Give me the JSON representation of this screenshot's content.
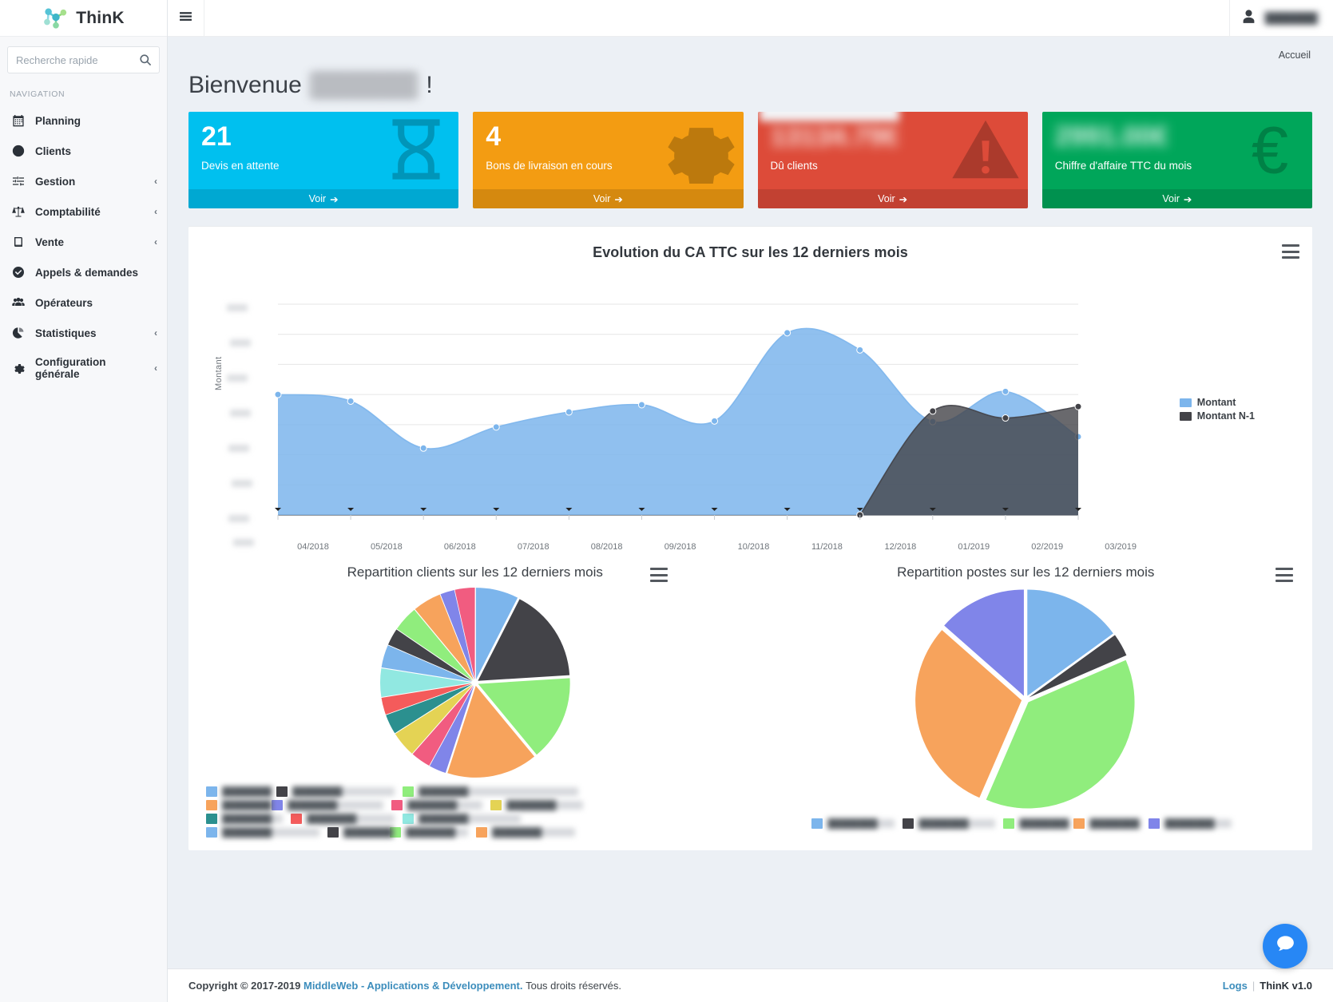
{
  "brand": {
    "name": "ThinK",
    "logo_icon": "molecule-logo-icon"
  },
  "topbar": {
    "menu_toggle_icon": "hamburger-menu-icon",
    "user_icon": "user-avatar-icon",
    "user_name": "███████"
  },
  "sidebar": {
    "search": {
      "placeholder": "Recherche rapide",
      "value": "",
      "icon": "search-icon"
    },
    "nav_header": "NAVIGATION",
    "items": [
      {
        "label": "Planning",
        "icon": "calendar-icon",
        "caret": ""
      },
      {
        "label": "Clients",
        "icon": "smiley-face-icon",
        "caret": ""
      },
      {
        "label": "Gestion",
        "icon": "sliders-icon",
        "caret": "‹"
      },
      {
        "label": "Comptabilité",
        "icon": "scales-balance-icon",
        "caret": "‹"
      },
      {
        "label": "Vente",
        "icon": "book-icon",
        "caret": "‹"
      },
      {
        "label": "Appels & demandes",
        "icon": "check-circle-icon",
        "caret": ""
      },
      {
        "label": "Opérateurs",
        "icon": "users-group-icon",
        "caret": ""
      },
      {
        "label": "Statistiques",
        "icon": "pie-chart-icon",
        "caret": "‹"
      },
      {
        "label": "Configuration générale",
        "icon": "gear-icon",
        "caret": "‹"
      }
    ]
  },
  "page": {
    "breadcrumb": "Accueil",
    "welcome_prefix": "Bienvenue",
    "welcome_name": "██████",
    "welcome_suffix": "!"
  },
  "kpis": [
    {
      "value": "21",
      "label": "Devis en attente",
      "link": "Voir",
      "icon": "hourglass-icon",
      "color": "#00c0ef",
      "foot_color": "#00acd6",
      "blurred": false
    },
    {
      "value": "4",
      "label": "Bons de livraison en cours",
      "link": "Voir",
      "icon": "gear-icon",
      "color": "#f39c12",
      "foot_color": "#e08e0b",
      "blurred": false
    },
    {
      "value": "13134.79€",
      "label": "Dû clients",
      "link": "Voir",
      "icon": "warning-triangle-icon",
      "color": "#dd4b39",
      "foot_color": "#d33724",
      "blurred": true
    },
    {
      "value": "2991.00€",
      "label": "Chiffre d'affaire TTC du mois",
      "link": "Voir",
      "icon": "euro-icon",
      "color": "#00a65a",
      "foot_color": "#008d4c",
      "blurred": true
    }
  ],
  "area_chart": {
    "title": "Evolution du CA TTC sur les 12 derniers mois",
    "export_icon": "hamburger-export-icon",
    "ylabel": "Montant",
    "legend": [
      {
        "name": "Montant",
        "color": "#7cb5ec"
      },
      {
        "name": "Montant N-1",
        "color": "#434348"
      }
    ]
  },
  "pies": [
    {
      "title": "Repartition clients sur les 12 derniers mois",
      "export_icon": "hamburger-export-icon",
      "legend_label_redacted": "████████"
    },
    {
      "title": "Repartition postes sur les 12 derniers mois",
      "export_icon": "hamburger-export-icon",
      "legend_label_redacted": "████████"
    }
  ],
  "footer": {
    "copyright_prefix": "Copyright © 2017-2019",
    "company_link": "MiddleWeb - Applications & Développement.",
    "rights": "Tous droits réservés.",
    "logs_link": "Logs",
    "separator": "|",
    "version": "ThinK v1.0"
  },
  "chat": {
    "icon": "chat-bubble-icon"
  },
  "chart_data": [
    {
      "type": "area",
      "title": "Evolution du CA TTC sur les 12 derniers mois",
      "xlabel": "",
      "ylabel": "Montant",
      "grid": true,
      "legend_position": "right",
      "categories": [
        "04/2018",
        "05/2018",
        "06/2018",
        "07/2018",
        "08/2018",
        "09/2018",
        "10/2018",
        "11/2018",
        "12/2018",
        "01/2019",
        "02/2019",
        "03/2019"
      ],
      "axis_tick_labels_redacted": true,
      "ylim": [
        0,
        7
      ],
      "series": [
        {
          "name": "Montant",
          "color": "#7cb5ec",
          "values": [
            4.0,
            3.78,
            2.22,
            2.92,
            3.42,
            3.66,
            3.12,
            6.05,
            5.48,
            3.1,
            4.1,
            2.6
          ]
        },
        {
          "name": "Montant N-1",
          "color": "#434348",
          "values": [
            null,
            null,
            null,
            null,
            null,
            null,
            null,
            null,
            0.0,
            3.45,
            3.22,
            3.6
          ]
        }
      ]
    },
    {
      "type": "pie",
      "title": "Repartition clients sur les 12 derniers mois",
      "labels_redacted": true,
      "slices": [
        {
          "color": "#7cb5ec",
          "value": 7.5
        },
        {
          "color": "#434348",
          "value": 16.5
        },
        {
          "color": "#90ed7d",
          "value": 15.0
        },
        {
          "color": "#f7a35c",
          "value": 16.0
        },
        {
          "color": "#8085e9",
          "value": 3.0
        },
        {
          "color": "#f15c80",
          "value": 3.5
        },
        {
          "color": "#e4d354",
          "value": 4.5
        },
        {
          "color": "#2b908f",
          "value": 3.5
        },
        {
          "color": "#f45b5b",
          "value": 3.0
        },
        {
          "color": "#91e8e1",
          "value": 5.0
        },
        {
          "color": "#7cb5ec",
          "value": 4.0
        },
        {
          "color": "#434348",
          "value": 3.0
        },
        {
          "color": "#90ed7d",
          "value": 4.5
        },
        {
          "color": "#f7a35c",
          "value": 5.0
        },
        {
          "color": "#8085e9",
          "value": 2.5
        },
        {
          "color": "#f15c80",
          "value": 3.5
        }
      ],
      "legend_rows": [
        [
          "#7cb5ec",
          "#434348",
          "#90ed7d"
        ],
        [
          "#f7a35c",
          "#8085e9",
          "#f15c80",
          "#e4d354"
        ],
        [
          "#2b908f",
          "#f45b5b",
          "#91e8e1"
        ],
        [
          "#7cb5ec",
          "#434348",
          "#90ed7d",
          "#f7a35c"
        ]
      ]
    },
    {
      "type": "pie",
      "title": "Repartition postes sur les 12 derniers mois",
      "labels_redacted": true,
      "slices": [
        {
          "color": "#7cb5ec",
          "value": 15.0
        },
        {
          "color": "#434348",
          "value": 3.5
        },
        {
          "color": "#90ed7d",
          "value": 38.0
        },
        {
          "color": "#f7a35c",
          "value": 30.0
        },
        {
          "color": "#8085e9",
          "value": 13.5
        }
      ],
      "legend_swatches": [
        "#7cb5ec",
        "#434348",
        "#90ed7d",
        "#f7a35c",
        "#8085e9"
      ]
    }
  ]
}
